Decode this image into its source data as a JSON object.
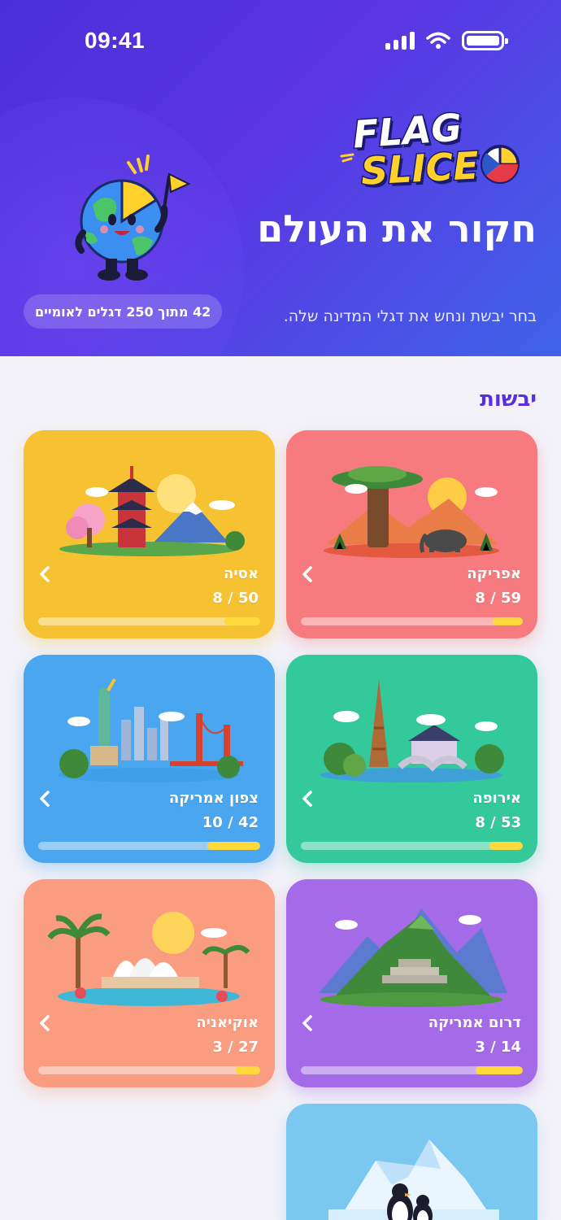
{
  "status_bar": {
    "time": "09:41"
  },
  "hero": {
    "logo_line1": "FLAG",
    "logo_line2": "SLICE",
    "title": "חקור את העולם",
    "subtitle": "בחר יבשת ונחש את דגלי המדינה שלה.",
    "progress_pill": "42 מתוך 250 דגלים לאומיים"
  },
  "section_title": "יבשות",
  "continents": [
    {
      "name": "אפריקה",
      "count": "8 / 59",
      "progress": 0.136,
      "color": "#f77b7e"
    },
    {
      "name": "אסיה",
      "count": "8 / 50",
      "progress": 0.16,
      "color": "#f6c232"
    },
    {
      "name": "אירופה",
      "count": "8 / 53",
      "progress": 0.151,
      "color": "#33c99a"
    },
    {
      "name": "צפון אמריקה",
      "count": "10 / 42",
      "progress": 0.238,
      "color": "#4aa6ee"
    },
    {
      "name": "דרום אמריקה",
      "count": "3 / 14",
      "progress": 0.214,
      "color": "#a56ae8"
    },
    {
      "name": "אוקיאניה",
      "count": "3 / 27",
      "progress": 0.111,
      "color": "#fa9c80"
    },
    {
      "name": "",
      "count": "",
      "progress": 0,
      "color": "#7ac8f0"
    }
  ]
}
